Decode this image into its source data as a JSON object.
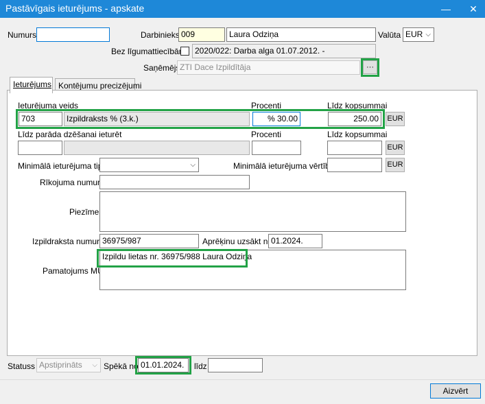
{
  "window": {
    "title": "Pastāvīgais ieturējums - apskate",
    "minimize_icon": "minimize-icon",
    "close_icon": "close-icon"
  },
  "header": {
    "numurs_label": "Numurs",
    "numurs_value": "",
    "darbinieks_label": "Darbinieks",
    "darbinieks_code": "009",
    "darbinieks_name": "Laura Odziņa",
    "valuta_label": "Valūta",
    "valuta_value": "EUR",
    "bez_ligumattiecibam_label": "Bez līgumattiecībām",
    "ligums_value": "2020/022: Darba alga  01.07.2012. -",
    "sanemejs_label": "Saņēmējs",
    "sanemejs_value": "ZTI Dace Izpildītāja",
    "browse_label": "···"
  },
  "tabs": [
    {
      "label": "Ieturējums"
    },
    {
      "label": "Kontējumu precizējumi"
    }
  ],
  "form": {
    "ieturejuma_veids_label": "Ieturējuma veids",
    "procenti_label": "Procenti",
    "lidz_kopsummai_label": "Līdz kopsummai",
    "veids_code": "703",
    "veids_name": "Izpildraksts % (3.k.)",
    "procenti_value": "% 30.00",
    "lidz_kopsummai_value": "250.00",
    "currency_btn": "EUR",
    "lidz_parada_label": "Līdz parāda dzēšanai ieturēt",
    "procenti2_label": "Procenti",
    "lidz_kopsummai2_label": "Līdz kopsummai",
    "currency_btn2": "EUR",
    "min_tips_label": "Minimālā ieturējuma tips",
    "min_vertiba_label": "Minimālā ieturējuma vērtība",
    "currency_btn3": "EUR",
    "rikojuma_label": "Rīkojuma numurs",
    "piezimes_label": "Piezīmes",
    "izpildraksta_label": "Izpildraksta numurs",
    "izpildraksta_value": "36975/987",
    "aprekinu_label": "Aprēķinu uzsākt no",
    "aprekinu_value": "01.2024.",
    "pamatojums_label": "Pamatojums MU",
    "pamatojums_value": "Izpildu lietas nr. 36975/988 Laura Odziņa"
  },
  "footer": {
    "statuss_label": "Statuss",
    "statuss_value": "Apstiprināts",
    "speka_label": "Spēkā no",
    "speka_value": "01.01.2024.",
    "lidz_label": "līdz",
    "lidz_value": "",
    "close_button": "Aizvērt"
  },
  "colors": {
    "titlebar": "#1e88d8",
    "highlight": "#22a246",
    "focus_blue": "#0078d7"
  }
}
